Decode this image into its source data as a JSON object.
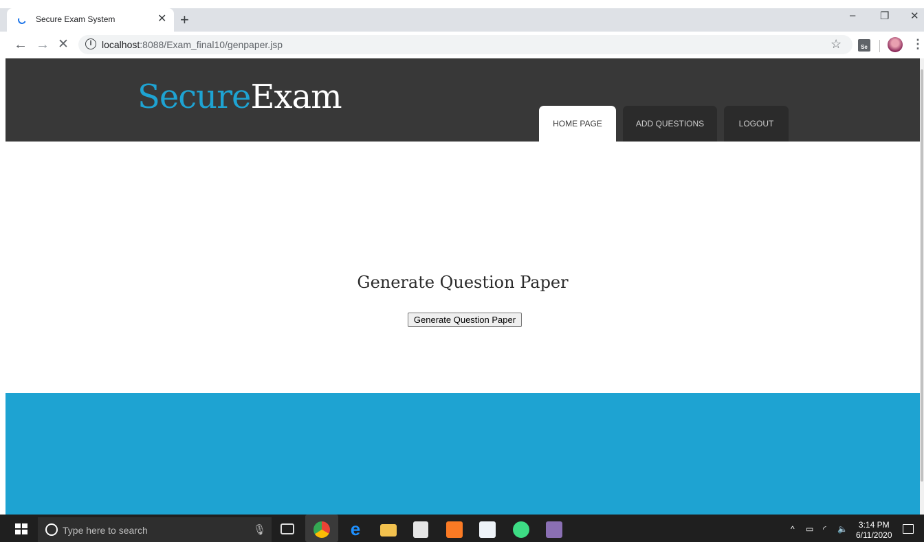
{
  "browser": {
    "tab_title": "Secure Exam System",
    "tab_close": "✕",
    "new_tab": "+",
    "url_host": "localhost",
    "url_rest": ":8088/Exam_final10/genpaper.jsp",
    "window_controls": {
      "minimize": "–",
      "restore": "❐",
      "close": "✕"
    }
  },
  "site": {
    "logo_part1": "Secure",
    "logo_part2": "Exam",
    "nav": [
      {
        "label": "HOME PAGE",
        "active": true
      },
      {
        "label": "ADD QUESTIONS",
        "active": false
      },
      {
        "label": "LOGOUT",
        "active": false
      }
    ],
    "colors": {
      "header": "#383838",
      "accent": "#1ea3d2"
    }
  },
  "main": {
    "title": "Generate Question Paper",
    "button_label": "Generate Question Paper"
  },
  "taskbar": {
    "search_placeholder": "Type here to search",
    "time": "3:14 PM",
    "date": "6/11/2020"
  }
}
